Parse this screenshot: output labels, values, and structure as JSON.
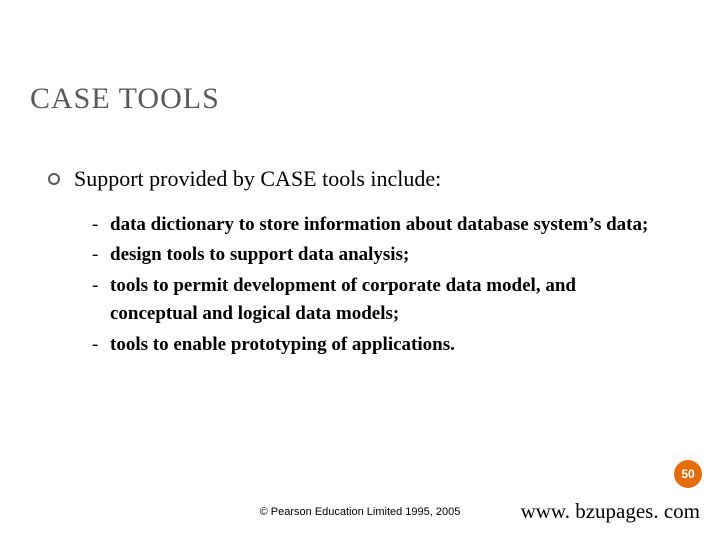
{
  "title": "CASE TOOLS",
  "lead": "Support provided by CASE tools include:",
  "items": [
    "data dictionary to store information about database system’s data;",
    "design tools to support data analysis;",
    "tools to permit development of corporate data model, and conceptual and logical data models;",
    "tools to enable prototyping of applications."
  ],
  "page_number": "50",
  "copyright": "© Pearson Education Limited 1995, 2005",
  "url": "www. bzupages. com"
}
